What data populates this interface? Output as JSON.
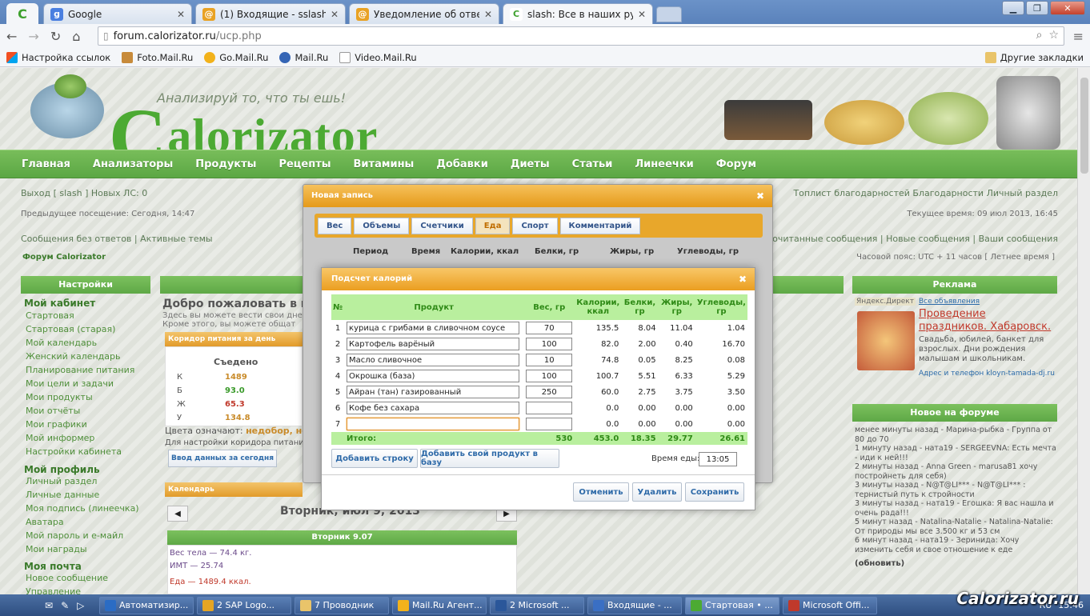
{
  "browser": {
    "tabs": [
      {
        "title": "Google",
        "icon": "google-icon"
      },
      {
        "title": "(1) Входящие - sslash@list.r",
        "icon": "mail-icon"
      },
      {
        "title": "Уведомление об ответе - «",
        "icon": "mail-icon"
      },
      {
        "title": "slash: Все в наших руках, п",
        "icon": "calorizator-icon",
        "active": true
      }
    ],
    "address_host": "forum.calorizator.ru",
    "address_path": "/ucp.php",
    "bookmarks": [
      "Настройка ссылок",
      "Foto.Mail.Ru",
      "Go.Mail.Ru",
      "Mail.Ru",
      "Video.Mail.Ru"
    ],
    "other_bookmarks": "Другие закладки"
  },
  "site": {
    "logo": "Calorizator",
    "logo_big_letter": "C",
    "logo_rest": "alorizator",
    "slogan": "Анализируй то, что ты ешь!",
    "brand_color": "#5ba744",
    "nav": [
      "Главная",
      "Анализаторы",
      "Продукты",
      "Рецепты",
      "Витамины",
      "Добавки",
      "Диеты",
      "Статьи",
      "Линеечки",
      "Форум"
    ],
    "user_line_left": "Выход [ slash ]   Новых ЛС: 0",
    "user_line_right": "Топлист благодарностей   Благодарности   Личный раздел",
    "last_visit": "Предыдущее посещение: Сегодня, 14:47",
    "current_time": "Текущее время: 09 июл 2013, 16:45",
    "links_left": "Сообщения без ответов | Активные темы",
    "links_right": "очитанные сообщения | Новые сообщения | Ваши сообщения",
    "forum_link": "Форум Calorizator",
    "timezone": "Часовой пояс: UTC + 11 часов [ Летнее время ]"
  },
  "sidebar": {
    "header": "Настройки",
    "cabinet": "Мой кабинет",
    "cabinet_links": [
      "Стартовая",
      "Стартовая (старая)",
      "Мой календарь",
      "Женский календарь",
      "Планирование питания",
      "Мои цели и задачи",
      "Мои продукты",
      "Мои отчёты",
      "Мои графики",
      "Мой информер",
      "Настройки кабинета"
    ],
    "profile": "Мой профиль",
    "profile_links": [
      "Личный раздел",
      "Личные данные",
      "Моя подпись (линеечка)",
      "Аватара",
      "Мой пароль и e-майл",
      "Мои награды"
    ],
    "mail": "Моя почта",
    "mail_links": [
      "Новое сообщение",
      "Управление"
    ]
  },
  "center": {
    "welcome": "Добро пожаловать в ваш",
    "line1": "Здесь вы можете вести свои дне",
    "line2": "Кроме этого, вы можете общат",
    "corridor": "Коридор питания за день",
    "eaten": "Съедено",
    "rows": [
      {
        "k": "К",
        "v": "1489"
      },
      {
        "k": "Б",
        "v": "93.0"
      },
      {
        "k": "Ж",
        "v": "65.3"
      },
      {
        "k": "У",
        "v": "134.8"
      }
    ],
    "legend": "Цвета означают: недобор, нор",
    "legend_strong": "недобор, нор",
    "settings_note": "Для настройки коридора питания",
    "enter_today": "Ввод данных за сегодня",
    "calendar": "Календарь",
    "calendar_date": "Вторник, июл 9, 2013",
    "day_header": "Вторник 9.07",
    "weight": "Вес тела — 74.4 кг.",
    "bmi": "ИМТ — 25.74",
    "food": "Еда — 1489.4 ккал."
  },
  "right": {
    "ads_header": "Реклама",
    "yandex": "Яндекс.Директ",
    "all_ads": "Все объявления",
    "ad_title": "Проведение праздников. Хабаровск.",
    "ad_text": "Свадьба, юбилей, банкет для взрослых. Дни рождения малышам и школьникам.",
    "ad_footer": "Адрес и телефон  kloyn-tamada-dj.ru",
    "forum_header": "Новое на форуме",
    "forum_text": "менее минуты назад - Марина-рыбка - Группа от 80 до 70\n1 минуту назад - ната19 - SERGEEVNA: Есть мечта - иди к ней!!!\n2 минуты назад - Anna Green - marusa81 хочу постройнеть для себя)\n3 минуты назад - N@T@LI*** - N@T@LI*** : тернистый путь к стройности\n3 минуты назад - ната19 - Егошка: Я вас нашла и очень рада!!!\n5 минут назад - Natalina-Natalie - Natalina-Natalie: От природы мы все 3.500 кг и 53 см\n6 минут назад - ната19 - Зеринида: Хочу изменить себя и свое отношение к еде",
    "refresh": "(обновить)"
  },
  "bg_modal": {
    "title": "Новая запись",
    "tabs": [
      "Вес",
      "Объемы",
      "Счетчики",
      "Еда",
      "Спорт",
      "Комментарий"
    ],
    "active_tab": "Еда",
    "cols": [
      "Период",
      "Время",
      "Калории, ккал",
      "Белки, гр",
      "Жиры, гр",
      "Углеводы, гр"
    ]
  },
  "calc": {
    "title": "Подсчет калорий",
    "headers": [
      "№",
      "Продукт",
      "Вес, гр",
      "Калории, ккал",
      "Белки, гр",
      "Жиры, гр",
      "Углеводы, гр"
    ],
    "rows": [
      {
        "n": "1",
        "product": "курица с грибами в сливочном соусе",
        "weight": "70",
        "kcal": "135.5",
        "prot": "8.04",
        "fat": "11.04",
        "carb": "1.04"
      },
      {
        "n": "2",
        "product": "Картофель варёный",
        "weight": "100",
        "kcal": "82.0",
        "prot": "2.00",
        "fat": "0.40",
        "carb": "16.70"
      },
      {
        "n": "3",
        "product": "Масло сливочное",
        "weight": "10",
        "kcal": "74.8",
        "prot": "0.05",
        "fat": "8.25",
        "carb": "0.08"
      },
      {
        "n": "4",
        "product": "Окрошка (база)",
        "weight": "100",
        "kcal": "100.7",
        "prot": "5.51",
        "fat": "6.33",
        "carb": "5.29"
      },
      {
        "n": "5",
        "product": "Айран (тан) газированный",
        "weight": "250",
        "kcal": "60.0",
        "prot": "2.75",
        "fat": "3.75",
        "carb": "3.50"
      },
      {
        "n": "6",
        "product": "Кофе без сахара",
        "weight": "",
        "kcal": "0.0",
        "prot": "0.00",
        "fat": "0.00",
        "carb": "0.00"
      },
      {
        "n": "7",
        "product": "",
        "weight": "",
        "kcal": "0.0",
        "prot": "0.00",
        "fat": "0.00",
        "carb": "0.00"
      }
    ],
    "total_label": "Итого:",
    "total": {
      "weight": "530",
      "kcal": "453.0",
      "prot": "18.35",
      "fat": "29.77",
      "carb": "26.61"
    },
    "add_row": "Добавить строку",
    "add_product": "Добавить свой продукт в базу",
    "meal_time_label": "Время еды:",
    "meal_time": "13:05",
    "cancel": "Отменить",
    "delete": "Удалить",
    "save": "Сохранить"
  },
  "taskbar": {
    "items": [
      "Автоматизир...",
      "2 SAP Logo...",
      "7 Проводник",
      "Mail.Ru Агент...",
      "2 Microsoft ...",
      "Входящие - ...",
      "Стартовая • ...",
      "Microsoft Offi..."
    ],
    "active_index": 6,
    "lang": "RU",
    "time": "15:46"
  },
  "watermark": "Calorizator.ru"
}
